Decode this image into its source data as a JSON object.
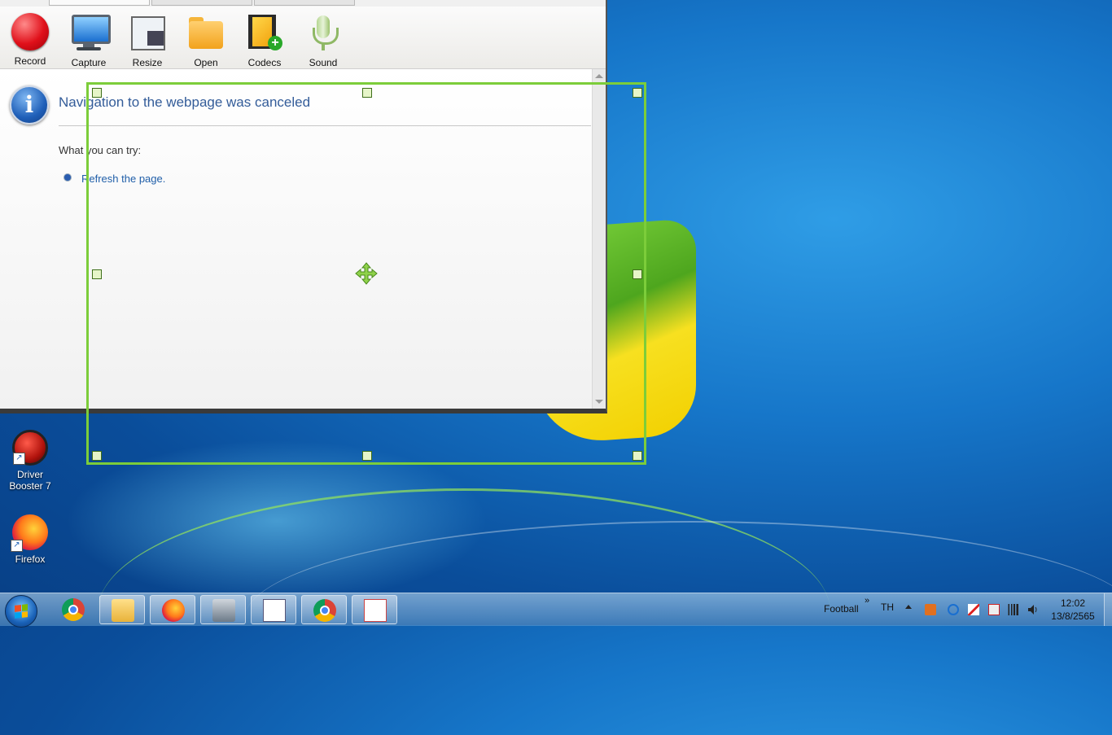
{
  "toolbar": {
    "items": [
      {
        "label": "Record",
        "icon": "record-icon"
      },
      {
        "label": "Capture",
        "icon": "monitor-icon"
      },
      {
        "label": "Resize",
        "icon": "resize-icon"
      },
      {
        "label": "Open",
        "icon": "folder-icon"
      },
      {
        "label": "Codecs",
        "icon": "codecs-icon"
      },
      {
        "label": "Sound",
        "icon": "microphone-icon"
      }
    ]
  },
  "browser_message": {
    "title": "Navigation to the webpage was canceled",
    "try_label": "What you can try:",
    "action_link": "Refresh the page."
  },
  "desktop": {
    "icons": [
      {
        "label_line1": "Driver",
        "label_line2": "Booster 7",
        "icon": "driver-booster-icon"
      },
      {
        "label": "Firefox",
        "icon": "firefox-icon"
      }
    ]
  },
  "taskbar": {
    "pinned": [
      "chrome",
      "windows-explorer",
      "firefox",
      "app",
      "wordpad",
      "chrome",
      "powerpoint"
    ],
    "toolbar_name": "Football",
    "overflow_glyph": "»",
    "language": "TH",
    "time": "12:02",
    "date": "13/8/2565"
  },
  "colors": {
    "selection_border": "#7ccd3a",
    "link": "#1f5ea8",
    "title": "#335c99"
  }
}
